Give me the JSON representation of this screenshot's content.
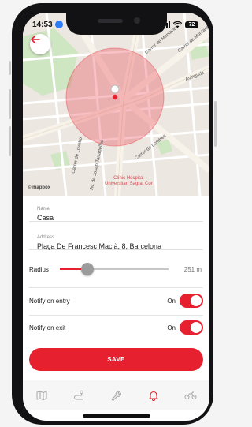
{
  "status_bar": {
    "time": "14:53",
    "battery": "72"
  },
  "map": {
    "labels": {
      "carrer_top_right": "Carrer de Muntaner",
      "carrer_right": "Carrer de Muntaner",
      "avinguda": "Avinguda",
      "carrer_lonres": "Carrer de Londres",
      "carrer_lovetto": "Carrer de Lovetto",
      "josep_tarradellas": "Av. de Josep Tarradellas",
      "hospital": "Clínic Hospital\nUniversitari Sagrat Cor",
      "mapbox": "© mapbox"
    },
    "geofence_color": "#e6202f"
  },
  "form": {
    "name_label": "Name",
    "name_value": "Casa",
    "address_label": "Address",
    "address_value": "Plaça De Francesc Macià, 8, Barcelona",
    "radius_label": "Radius",
    "radius_value": "251 m",
    "radius_fraction": 0.25,
    "notify_entry_label": "Notify on entry",
    "notify_entry_state": "On",
    "notify_exit_label": "Notify on exit",
    "notify_exit_state": "On",
    "save_label": "SAVE"
  },
  "tab_bar": {
    "items": [
      "map-icon",
      "route-icon",
      "wrench-icon",
      "bell-icon",
      "motorbike-icon"
    ],
    "active": "bell-icon"
  },
  "colors": {
    "accent": "#e6202f"
  }
}
